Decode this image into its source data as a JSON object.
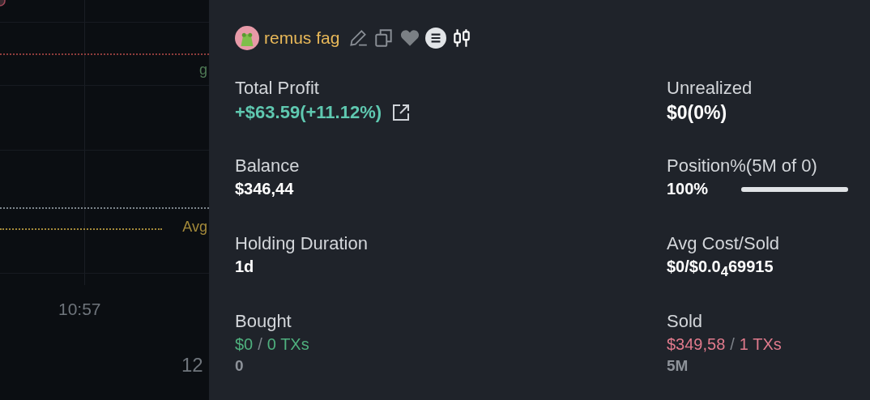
{
  "chart": {
    "price_lines": [
      {
        "color": "#8f3c3c",
        "label": {
          "text": "g",
          "color": "#4f7a55"
        }
      },
      {
        "color": "#7d858c"
      },
      {
        "color": "#a48a3a",
        "label": {
          "text": "Avg",
          "color": "#a48a3a"
        }
      }
    ],
    "time_labels": [
      "10:57"
    ],
    "date_labels": [
      "12"
    ]
  },
  "panel": {
    "wallet_name": "remus fag",
    "total_profit": {
      "label": "Total Profit",
      "value": "+$63.59(+11.12%)"
    },
    "unrealized": {
      "label": "Unrealized",
      "value": "$0(0%)"
    },
    "balance": {
      "label": "Balance",
      "value": "$346,44"
    },
    "position": {
      "label": "Position%(5M of 0)",
      "value": "100%",
      "level": 1
    },
    "holding_duration": {
      "label": "Holding Duration",
      "value": "1d"
    },
    "avg_cost_sold": {
      "label": "Avg Cost/Sold",
      "value": "$0/$0.0$_{4}$69915"
    },
    "bought": {
      "label": "Bought",
      "amount": "$0",
      "separator": "/",
      "txs": "0 TXs",
      "tokens": "0"
    },
    "sold": {
      "label": "Sold",
      "amount": "$349,58",
      "separator": "/",
      "txs": "1 TXs",
      "tokens": "5M"
    }
  }
}
